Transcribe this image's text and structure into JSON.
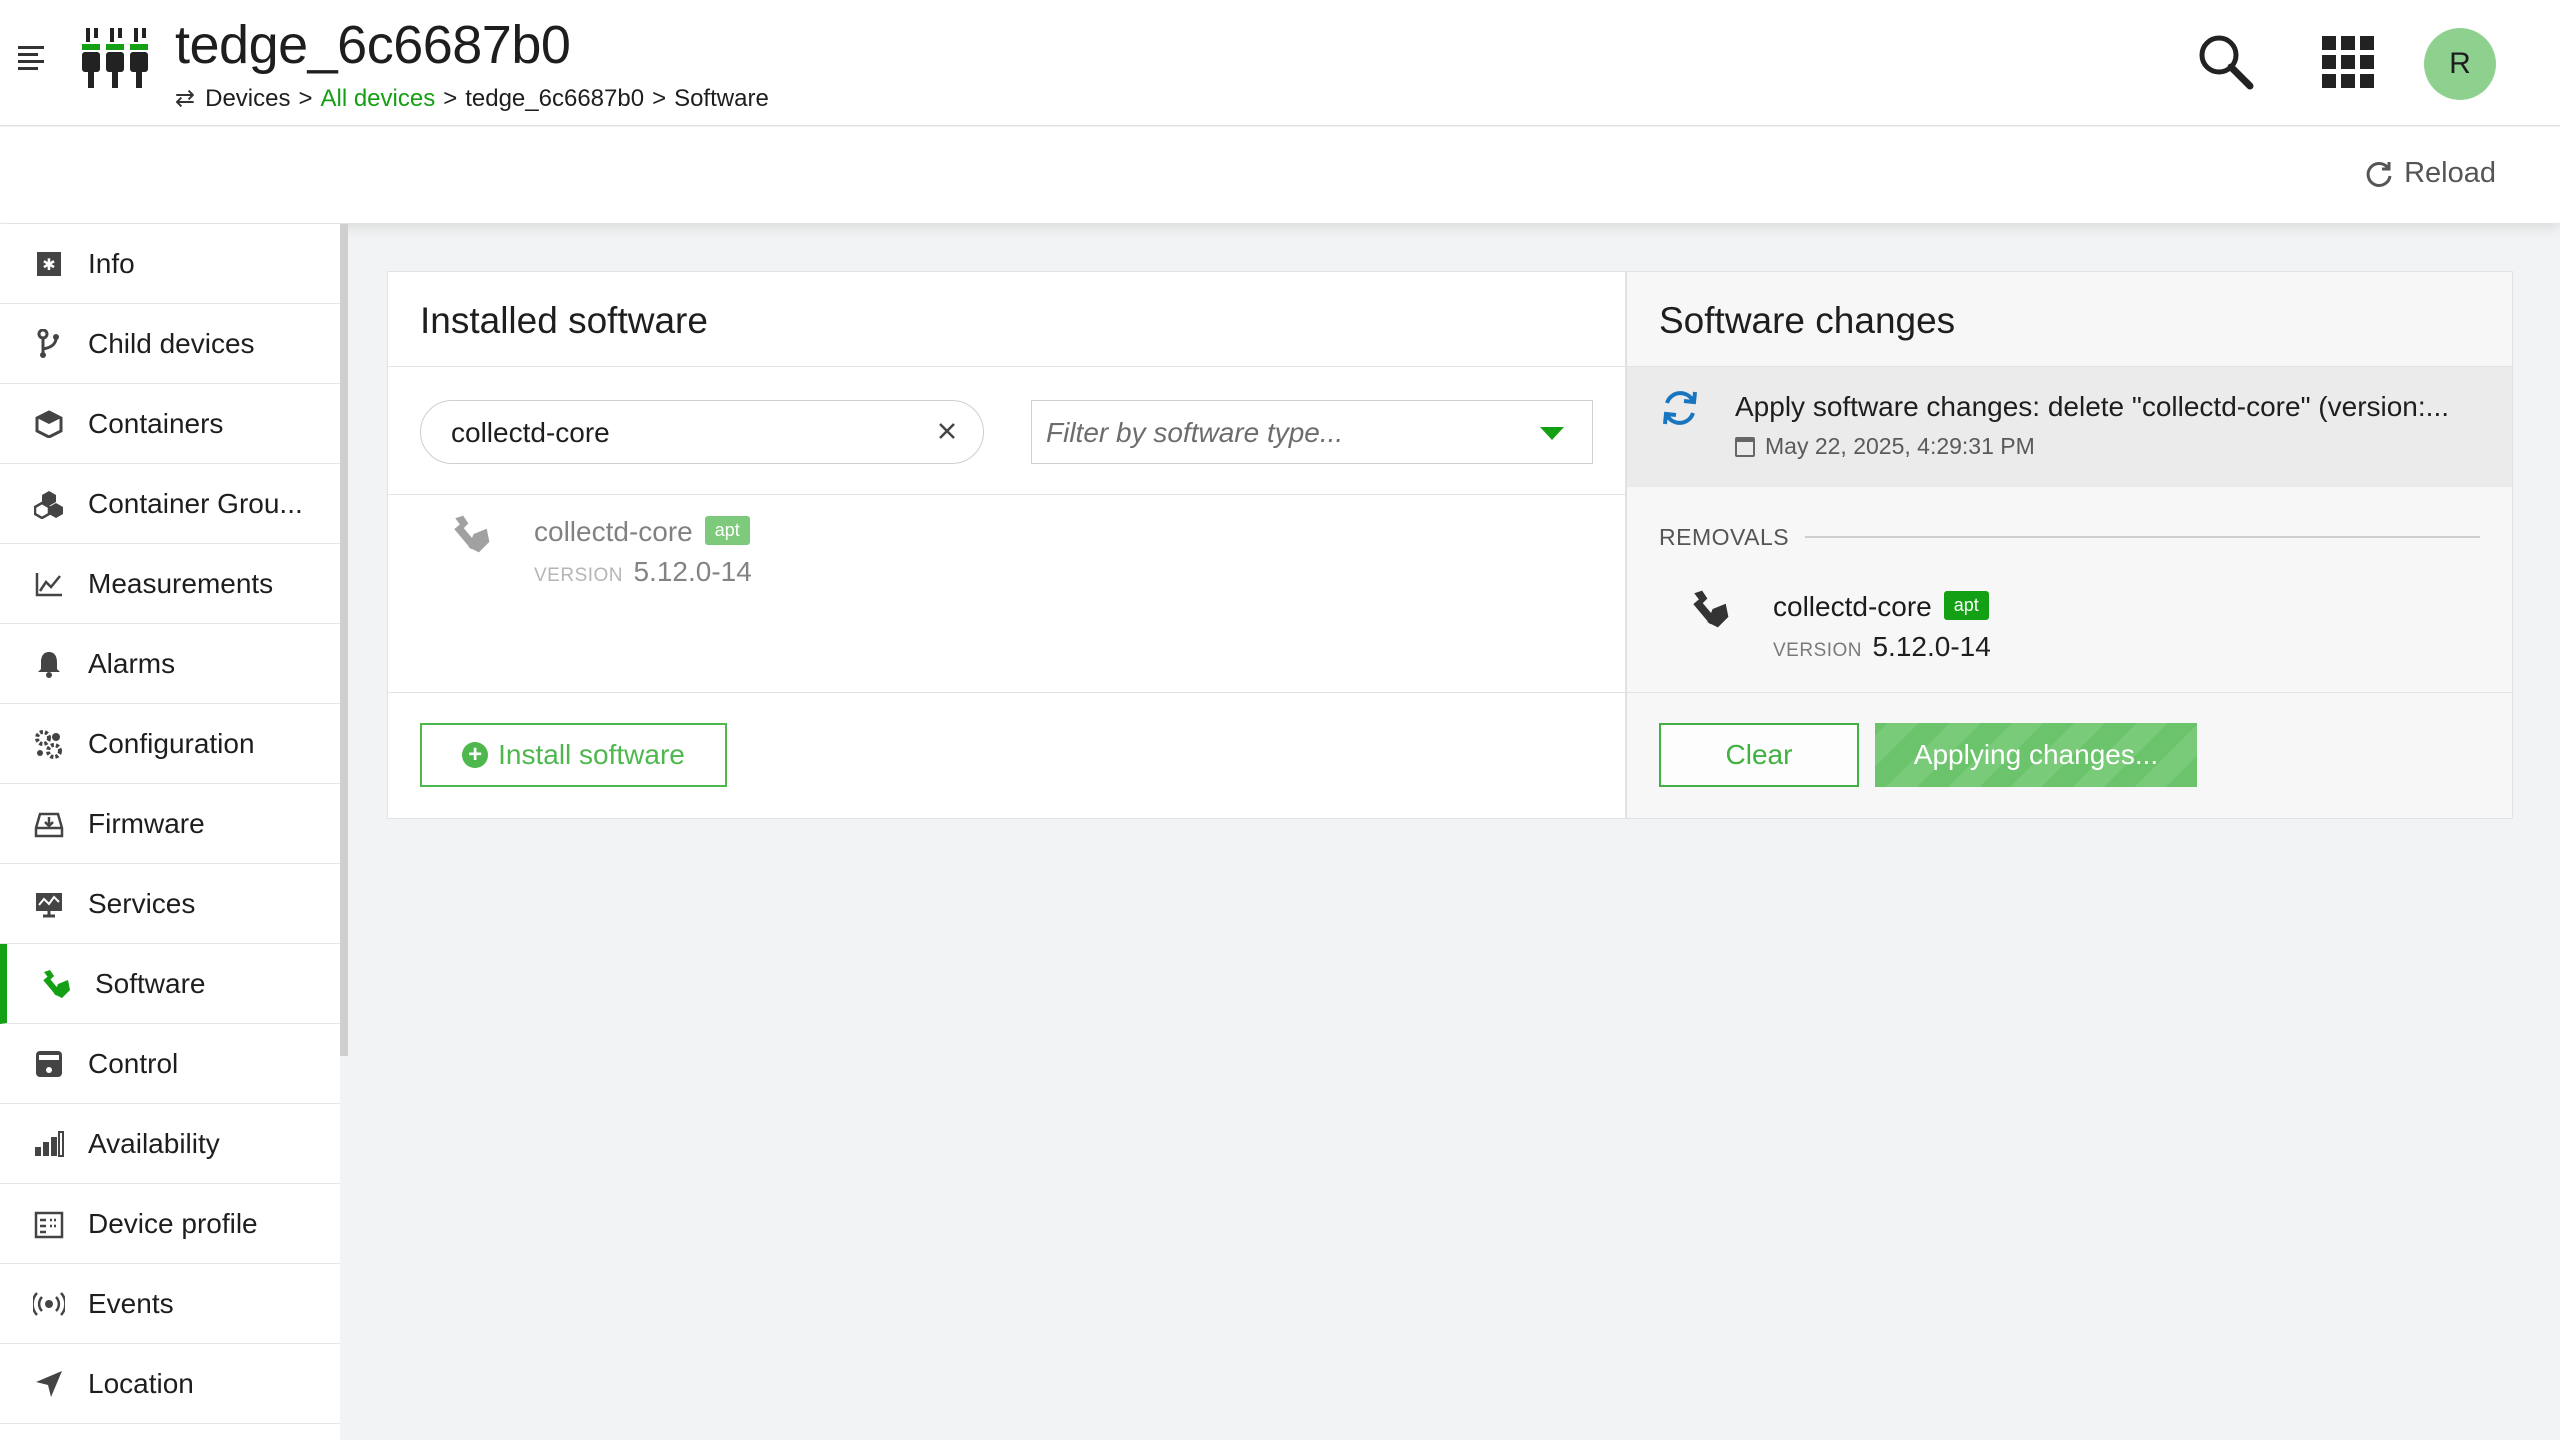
{
  "header": {
    "title": "tedge_6c6687b0",
    "breadcrumb": {
      "root": "Devices",
      "sep1": ">",
      "all_devices": "All devices",
      "sep2": ">",
      "device": "tedge_6c6687b0",
      "sep3": ">",
      "current": "Software"
    },
    "avatar_initial": "R"
  },
  "actionbar": {
    "reload_label": "Reload"
  },
  "sidebar": {
    "items": [
      {
        "label": "Info",
        "icon": "info-icon"
      },
      {
        "label": "Child devices",
        "icon": "child-devices-icon"
      },
      {
        "label": "Containers",
        "icon": "containers-icon"
      },
      {
        "label": "Container Grou...",
        "icon": "container-groups-icon"
      },
      {
        "label": "Measurements",
        "icon": "measurements-icon"
      },
      {
        "label": "Alarms",
        "icon": "bell-icon"
      },
      {
        "label": "Configuration",
        "icon": "configuration-icon"
      },
      {
        "label": "Firmware",
        "icon": "firmware-icon"
      },
      {
        "label": "Services",
        "icon": "services-icon"
      },
      {
        "label": "Software",
        "icon": "software-icon",
        "active": true
      },
      {
        "label": "Control",
        "icon": "control-icon"
      },
      {
        "label": "Availability",
        "icon": "availability-icon"
      },
      {
        "label": "Device profile",
        "icon": "device-profile-icon"
      },
      {
        "label": "Events",
        "icon": "events-icon"
      },
      {
        "label": "Location",
        "icon": "location-icon"
      }
    ]
  },
  "installed": {
    "title": "Installed software",
    "search_value": "collectd-core",
    "filter_placeholder": "Filter by software type...",
    "items": [
      {
        "name": "collectd-core",
        "type": "apt",
        "version_label": "VERSION",
        "version": "5.12.0-14"
      }
    ],
    "install_button": "Install software"
  },
  "changes": {
    "title": "Software changes",
    "operation_title": "Apply software changes: delete \"collectd-core\" (version:...",
    "operation_date": "May 22, 2025, 4:29:31 PM",
    "removals_label": "REMOVALS",
    "removals": [
      {
        "name": "collectd-core",
        "type": "apt",
        "version_label": "VERSION",
        "version": "5.12.0-14"
      }
    ],
    "clear_button": "Clear",
    "apply_button": "Applying changes..."
  },
  "colors": {
    "accent": "#14a014",
    "avatar_bg": "#8ed18e",
    "sync_blue": "#1776bf"
  }
}
